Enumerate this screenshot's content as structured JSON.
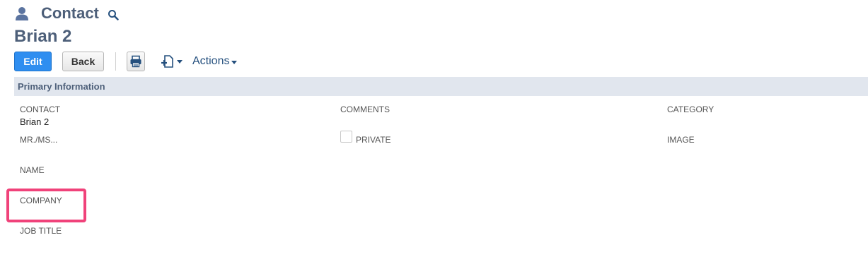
{
  "header": {
    "page_type": "Contact",
    "person_icon": "person-icon",
    "search_icon": "search-icon"
  },
  "record": {
    "title": "Brian 2"
  },
  "toolbar": {
    "edit_label": "Edit",
    "back_label": "Back",
    "print_icon": "print-icon",
    "new_doc_icon": "new-document-icon",
    "actions_label": "Actions"
  },
  "section": {
    "title": "Primary Information"
  },
  "fields": {
    "contact_label": "CONTACT",
    "contact_value": "Brian 2",
    "mr_ms_label": "MR./MS...",
    "name_label": "NAME",
    "company_label": "COMPANY",
    "job_title_label": "JOB TITLE",
    "comments_label": "COMMENTS",
    "private_label": "PRIVATE",
    "category_label": "CATEGORY",
    "image_label": "IMAGE"
  },
  "colors": {
    "accent": "#2f8ef0",
    "title": "#4d5f79",
    "section_bg": "#e1e6ee",
    "highlight": "#f0427a",
    "link": "#25507e"
  }
}
